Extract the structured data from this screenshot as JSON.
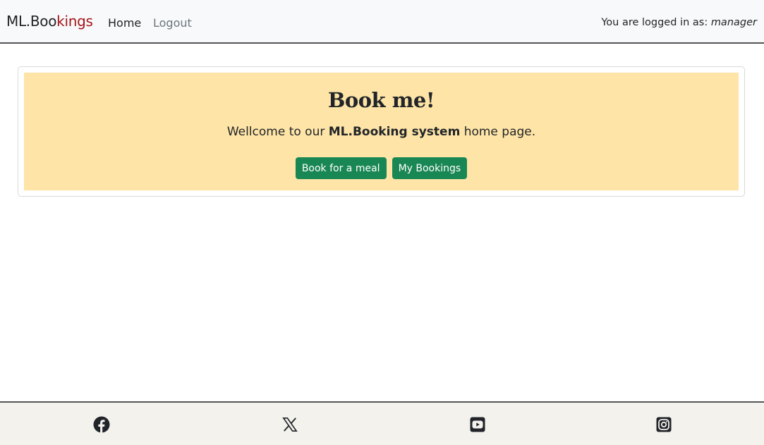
{
  "navbar": {
    "brand_prefix": "ML.Boo",
    "brand_suffix": "kings",
    "links": [
      {
        "label": "Home"
      },
      {
        "label": "Logout"
      }
    ],
    "user_prefix": "You are logged in as:",
    "username": "manager"
  },
  "hero": {
    "title": "Book me!",
    "text_before": "Wellcome to our ",
    "text_bold": "ML.Booking system",
    "text_after": " home page.",
    "buttons": [
      {
        "label": "Book for a meal"
      },
      {
        "label": "My Bookings"
      }
    ]
  },
  "footer": {
    "icons": [
      "facebook-icon",
      "x-icon",
      "youtube-icon",
      "instagram-icon"
    ]
  },
  "colors": {
    "brand_accent": "#a4161a",
    "button": "#198754",
    "hero_bg": "#fee4a6",
    "footer_bg": "#f3f2ed"
  }
}
